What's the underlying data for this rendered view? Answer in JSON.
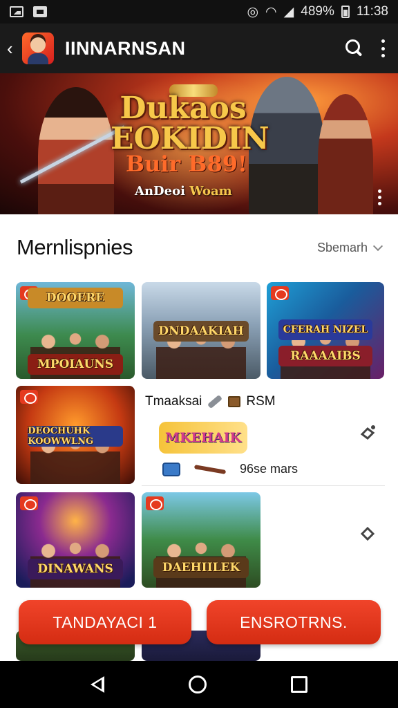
{
  "status_bar": {
    "battery": "489%",
    "time": "11:38"
  },
  "app_bar": {
    "title": "IINNARNSAN"
  },
  "hero": {
    "title_line1": "Dukaos",
    "title_line2": "EOKIDIN",
    "title_line3": "Buir B89!",
    "tagline_a": "AnDeoi",
    "tagline_b": "Woam"
  },
  "section": {
    "title": "Mernlispnies",
    "sort_label": "Sbemarh"
  },
  "tiles": [
    {
      "band_top": "DOOERE",
      "band_bottom": "MPOIAUNS"
    },
    {
      "band_top": "DNDAAKIAH"
    },
    {
      "band_top": "CFERAH NIZEL",
      "band_bottom": "RAAAAIBS"
    },
    {
      "band_top": "DEOCHUHK KOOWWLNG"
    },
    {
      "band_top": "DINAWANS"
    },
    {
      "band_top": "DAEHIILEK"
    }
  ],
  "detail": {
    "title": "Tmaaksai",
    "size": "RSM",
    "logo": "MKEHAIK",
    "meta": "96se mars"
  },
  "cta": {
    "primary": "TANDAYACI 1",
    "secondary": "ENSROTRNS."
  },
  "colors": {
    "accent": "#e03a1e",
    "bar": "#1b1b1b"
  }
}
